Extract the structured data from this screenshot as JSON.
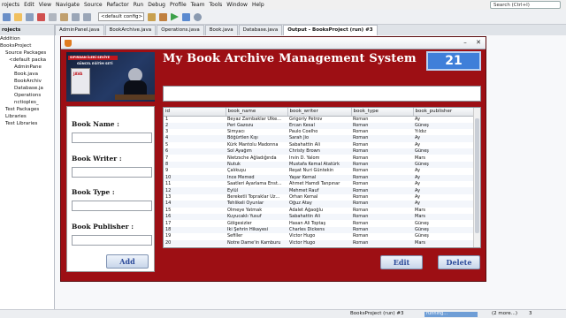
{
  "ide": {
    "menu": [
      "rojects",
      "Edit",
      "View",
      "Navigate",
      "Source",
      "Refactor",
      "Run",
      "Debug",
      "Profile",
      "Team",
      "Tools",
      "Window",
      "Help"
    ],
    "search_placeholder": "Search (Ctrl+I)",
    "config": "<default config>",
    "tabs": [
      "AdminPanel.java",
      "BookArchive.java",
      "Operations.java",
      "Book.java",
      "Database.java",
      "Output - BooksProject (run) #3"
    ],
    "active_tab_index": 5,
    "projects_title": "rojects",
    "tree": [
      "Addition",
      "BooksProject",
      "Source Packages",
      "<default packa",
      "AdminPane",
      "Book.java",
      "BookArchiv",
      "Database.ja",
      "Operations",
      "nctioples_",
      "Test Packages",
      "Libraries",
      "Test Libraries"
    ],
    "status": {
      "run": "BooksProject (run) #3",
      "running": "running...",
      "more": "(2 more...)",
      "count": "3"
    }
  },
  "app": {
    "title": "My Book Archive Management System",
    "record_count": "21",
    "banner": {
      "brand": "JAVA",
      "line1": "SIFIRDAN İLERİ SEVİYE",
      "line2": "GÜNCEL EĞİTİM SETİ"
    },
    "form": {
      "name_label": "Book Name :",
      "writer_label": "Book Writer :",
      "type_label": "Book Type :",
      "publisher_label": "Book Publisher :"
    },
    "buttons": {
      "add": "Add",
      "edit": "Edit",
      "delete": "Delete"
    },
    "table": {
      "columns": [
        "id",
        "book_name",
        "book_writer",
        "book_type",
        "book_publisher"
      ],
      "rows": [
        [
          "1",
          "Beyaz Zambaklar Ülke...",
          "Grigoriy Petrov",
          "Roman",
          "Ay"
        ],
        [
          "2",
          "Peri Gazozu",
          "Ercan Kesal",
          "Roman",
          "Güneş"
        ],
        [
          "3",
          "Simyacı",
          "Paulo Coelho",
          "Roman",
          "Yıldız"
        ],
        [
          "4",
          "Böğürtlen Kışı",
          "Sarah Jio",
          "Roman",
          "Ay"
        ],
        [
          "5",
          "Kürk Mantolu Madonna",
          "Sabahattin Ali",
          "Roman",
          "Ay"
        ],
        [
          "6",
          "Sol Ayağım",
          "Christy Brown",
          "Roman",
          "Güneş"
        ],
        [
          "7",
          "Nietzsche Ağladığında",
          "Irvin D. Yalom",
          "Roman",
          "Mars"
        ],
        [
          "8",
          "Nutuk",
          "Mustafa Kemal Atatürk",
          "Roman",
          "Güneş"
        ],
        [
          "9",
          "Çalıkuşu",
          "Reşat Nuri Güntekin",
          "Roman",
          "Ay"
        ],
        [
          "10",
          "İnce Memed",
          "Yaşar Kemal",
          "Roman",
          "Ay"
        ],
        [
          "11",
          "Saatleri Ayarlama Enst...",
          "Ahmet Hamdi Tanpınar",
          "Roman",
          "Ay"
        ],
        [
          "12",
          "Eylül",
          "Mehmet Rauf",
          "Roman",
          "Ay"
        ],
        [
          "13",
          "Bereketli Topraklar Üz...",
          "Orhan Kemal",
          "Roman",
          "Ay"
        ],
        [
          "14",
          "Tehlikeli Oyunlar",
          "Oğuz Atay",
          "Roman",
          "Ay"
        ],
        [
          "15",
          "Ölmeye Yatmak",
          "Adalet Ağaoğlu",
          "Roman",
          "Mars"
        ],
        [
          "16",
          "Kuyucaklı Yusuf",
          "Sabahattin Ali",
          "Roman",
          "Mars"
        ],
        [
          "17",
          "Gölgesizler",
          "Hasan Ali Toptaş",
          "Roman",
          "Güneş"
        ],
        [
          "18",
          "İki Şehrin Hikayesi",
          "Charles Dickens",
          "Roman",
          "Güneş"
        ],
        [
          "19",
          "Sefiller",
          "Victor Hugo",
          "Roman",
          "Güneş"
        ],
        [
          "20",
          "Notre Dame'in Kamburu",
          "Victor Hugo",
          "Roman",
          "Mars"
        ]
      ]
    }
  },
  "colors": {
    "app_bg": "#9d0f14",
    "count_bg": "#3f7fd9"
  },
  "icons": [
    "java-cup-icon",
    "minimize-icon",
    "close-icon"
  ]
}
